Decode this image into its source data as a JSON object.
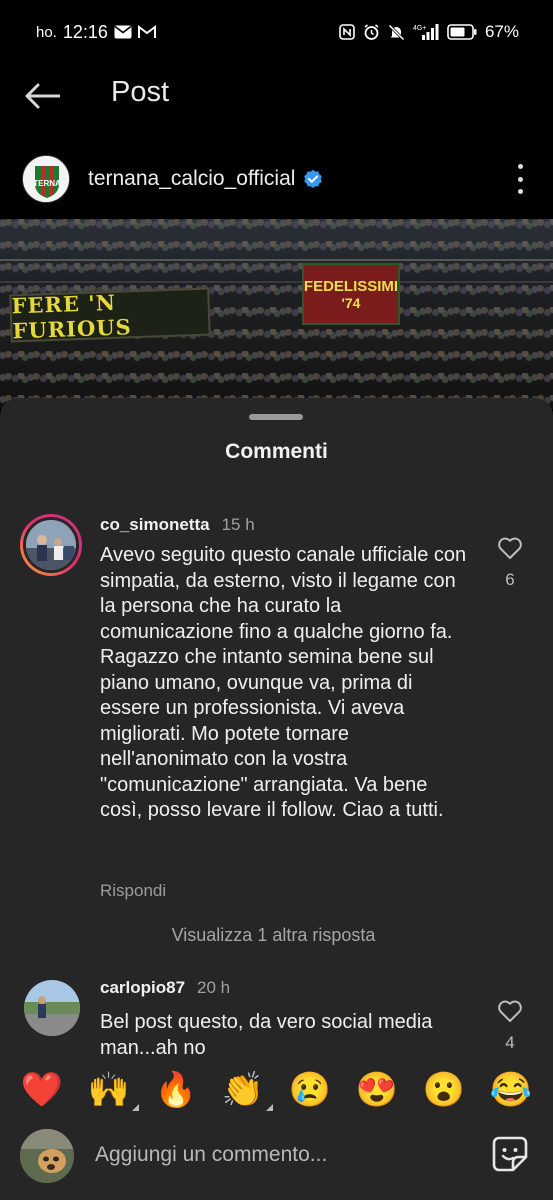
{
  "status_bar": {
    "carrier": "ho.",
    "time": "12:16",
    "network": "4G+",
    "battery": "67%"
  },
  "header": {
    "title": "Post"
  },
  "post": {
    "author": "ternana_calcio_official",
    "verified": true,
    "avatar_text": "TERNA",
    "banner_left": "FERE 'N FURIOUS",
    "banner_right_top": "FEDELISSIMI",
    "banner_right_num": "'74"
  },
  "comments_sheet": {
    "title": "Commenti",
    "comments": [
      {
        "username": "co_simonetta",
        "time": "15 h",
        "text": "Avevo seguito questo canale ufficiale con simpatia, da esterno, visto il legame con la persona che ha curato la comunicazione fino a qualche giorno fa. Ragazzo che intanto semina bene sul piano umano, ovunque va, prima di essere un professionista. Vi aveva migliorati. Mo potete tornare nell'anonimato con la vostra \"comunicazione\" arrangiata. Va bene così, posso levare il follow. Ciao a tutti.",
        "likes": "6",
        "reply_label": "Rispondi"
      },
      {
        "username": "carlopio87",
        "time": "20 h",
        "text": "Bel post questo,  da vero social media man...ah no",
        "likes": "4"
      }
    ],
    "view_replies": "Visualizza 1 altra risposta"
  },
  "reactions": [
    {
      "name": "heart",
      "glyph": "❤️",
      "has_variants": false
    },
    {
      "name": "raised-hands",
      "glyph": "🙌",
      "has_variants": true
    },
    {
      "name": "fire",
      "glyph": "🔥",
      "has_variants": false
    },
    {
      "name": "clapping-hands",
      "glyph": "👏",
      "has_variants": true
    },
    {
      "name": "crying-face",
      "glyph": "😢",
      "has_variants": false
    },
    {
      "name": "heart-eyes",
      "glyph": "😍",
      "has_variants": false
    },
    {
      "name": "surprised-face",
      "glyph": "😮",
      "has_variants": false
    },
    {
      "name": "laughing-tears",
      "glyph": "😂",
      "has_variants": false
    }
  ],
  "composer": {
    "placeholder": "Aggiungi un commento..."
  },
  "colors": {
    "background": "#000000",
    "sheet": "#262626",
    "verified": "#3897f0",
    "text": "#efefef",
    "muted": "#9c9c9c"
  }
}
